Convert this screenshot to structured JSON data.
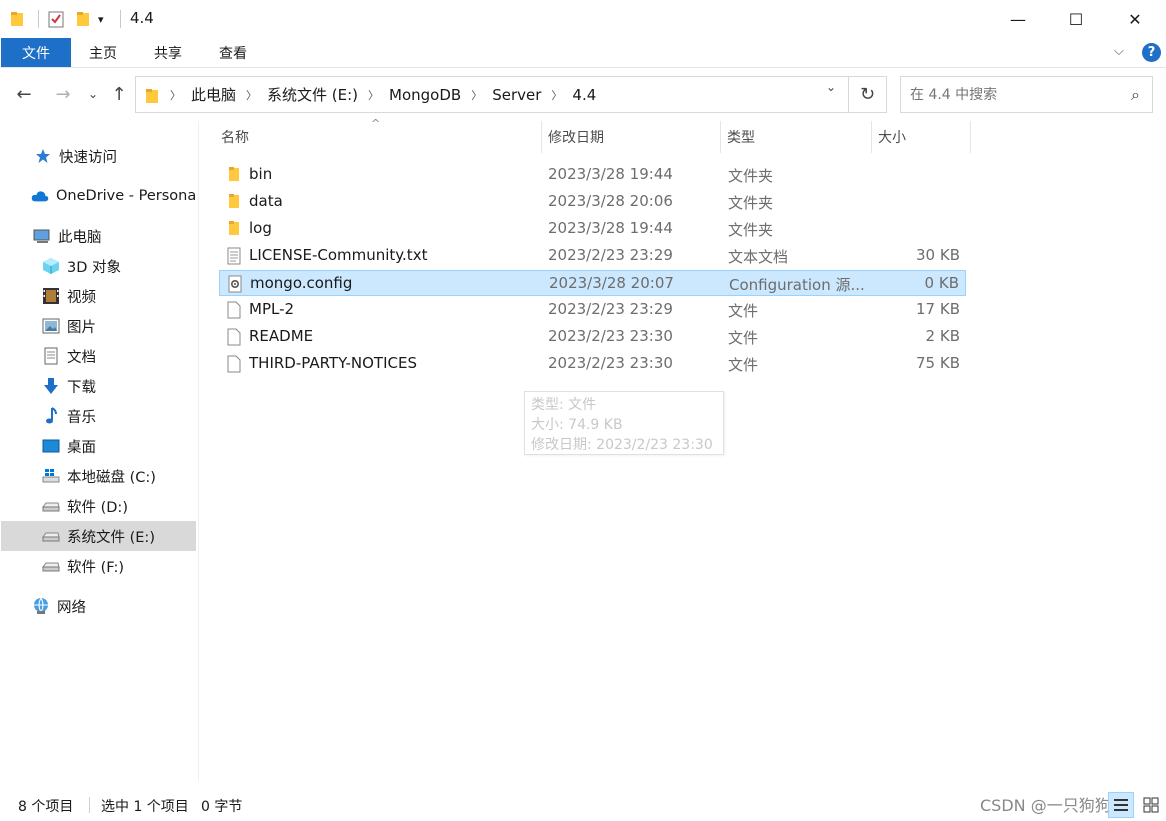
{
  "window": {
    "title": "4.4",
    "controls": {
      "minimize": "—",
      "maximize": "☐",
      "close": "✕"
    }
  },
  "ribbon": {
    "tabs": [
      {
        "label": "文件",
        "active": true
      },
      {
        "label": "主页",
        "active": false
      },
      {
        "label": "共享",
        "active": false
      },
      {
        "label": "查看",
        "active": false
      }
    ],
    "help": "?"
  },
  "address": {
    "crumbs": [
      "此电脑",
      "系统文件 (E:)",
      "MongoDB",
      "Server",
      "4.4"
    ]
  },
  "search": {
    "placeholder": "在 4.4 中搜索"
  },
  "sidebar": {
    "items": [
      {
        "label": "快速访问",
        "icon": "star-icon"
      },
      {
        "label": "OneDrive - Persona",
        "icon": "cloud-icon"
      },
      {
        "label": "此电脑",
        "icon": "computer-icon"
      },
      {
        "label": "3D 对象",
        "icon": "cube-icon"
      },
      {
        "label": "视频",
        "icon": "film-icon"
      },
      {
        "label": "图片",
        "icon": "picture-icon"
      },
      {
        "label": "文档",
        "icon": "document-icon"
      },
      {
        "label": "下载",
        "icon": "download-icon"
      },
      {
        "label": "音乐",
        "icon": "music-icon"
      },
      {
        "label": "桌面",
        "icon": "desktop-icon"
      },
      {
        "label": "本地磁盘 (C:)",
        "icon": "windows-drive-icon"
      },
      {
        "label": "软件 (D:)",
        "icon": "drive-icon"
      },
      {
        "label": "系统文件 (E:)",
        "icon": "drive-icon",
        "selected": true
      },
      {
        "label": "软件 (F:)",
        "icon": "drive-icon"
      },
      {
        "label": "网络",
        "icon": "network-icon"
      }
    ]
  },
  "columns": {
    "name": "名称",
    "date": "修改日期",
    "type": "类型",
    "size": "大小"
  },
  "files": [
    {
      "name": "bin",
      "date": "2023/3/28 19:44",
      "type": "文件夹",
      "size": "",
      "icon": "folder-icon"
    },
    {
      "name": "data",
      "date": "2023/3/28 20:06",
      "type": "文件夹",
      "size": "",
      "icon": "folder-icon"
    },
    {
      "name": "log",
      "date": "2023/3/28 19:44",
      "type": "文件夹",
      "size": "",
      "icon": "folder-icon"
    },
    {
      "name": "LICENSE-Community.txt",
      "date": "2023/2/23 23:29",
      "type": "文本文档",
      "size": "30 KB",
      "icon": "text-file-icon"
    },
    {
      "name": "mongo.config",
      "date": "2023/3/28 20:07",
      "type": "Configuration 源...",
      "size": "0 KB",
      "icon": "config-file-icon",
      "selected": true
    },
    {
      "name": "MPL-2",
      "date": "2023/2/23 23:29",
      "type": "文件",
      "size": "17 KB",
      "icon": "file-icon"
    },
    {
      "name": "README",
      "date": "2023/2/23 23:30",
      "type": "文件",
      "size": "2 KB",
      "icon": "file-icon"
    },
    {
      "name": "THIRD-PARTY-NOTICES",
      "date": "2023/2/23 23:30",
      "type": "文件",
      "size": "75 KB",
      "icon": "file-icon"
    }
  ],
  "tooltip": {
    "lines": [
      "类型: 文件",
      "大小: 74.9 KB",
      "修改日期: 2023/2/23 23:30"
    ]
  },
  "status": {
    "count": "8 个项目",
    "selected": "选中 1 个项目",
    "selected_size": "0 字节"
  },
  "watermark": "CSDN @一只狗狗员",
  "colors": {
    "accent": "#1e6fc8",
    "selection": "#cce8ff",
    "selection_border": "#99d1ff",
    "folder": "#ffc83d"
  }
}
